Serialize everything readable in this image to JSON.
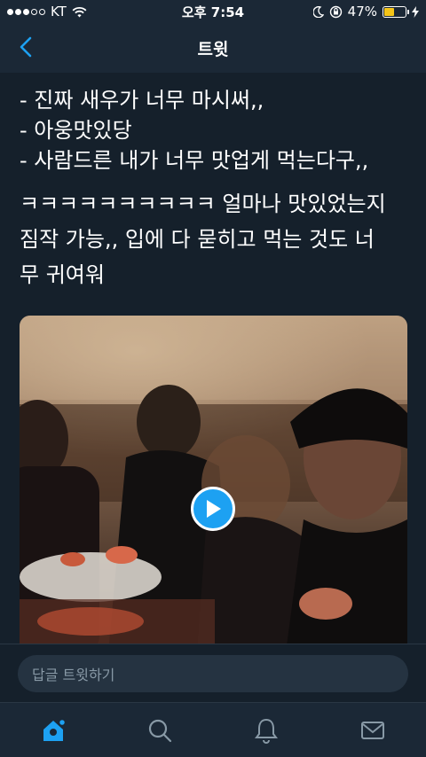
{
  "status_bar": {
    "carrier": "KT",
    "time": "오후 7:54",
    "battery_percent": "47%",
    "battery_level": 0.47,
    "icons": [
      "signal-dots-icon",
      "wifi-icon",
      "moon-icon",
      "rotation-lock-icon",
      "battery-icon",
      "charging-icon"
    ]
  },
  "nav": {
    "title": "트윗",
    "back_icon": "chevron-left-icon"
  },
  "tweet": {
    "lines": [
      "- 진짜 새우가 너무 마시써,,",
      "- 아웅맛있당",
      "- 사람드른 내가 너무 맛업게 먹는다구,,"
    ],
    "paragraph2_lines": [
      "ㅋㅋㅋㅋㅋㅋㅋㅋㅋㅋ 얼마나 맛있었는지",
      "짐작 가능,, 입에 다 묻히고 먹는 것도 너",
      "무 귀여워"
    ]
  },
  "media": {
    "type": "video",
    "play_icon": "play-icon"
  },
  "reply": {
    "placeholder": "답글 트윗하기"
  },
  "tab_bar": {
    "tabs": [
      {
        "name": "home",
        "icon": "home-icon",
        "active": true
      },
      {
        "name": "search",
        "icon": "search-icon",
        "active": false
      },
      {
        "name": "notifications",
        "icon": "bell-icon",
        "active": false
      },
      {
        "name": "messages",
        "icon": "mail-icon",
        "active": false
      }
    ]
  },
  "colors": {
    "background": "#15202b",
    "bar": "#1b2836",
    "accent": "#1da1f2",
    "battery": "#f5c518",
    "muted": "#8899a6"
  }
}
